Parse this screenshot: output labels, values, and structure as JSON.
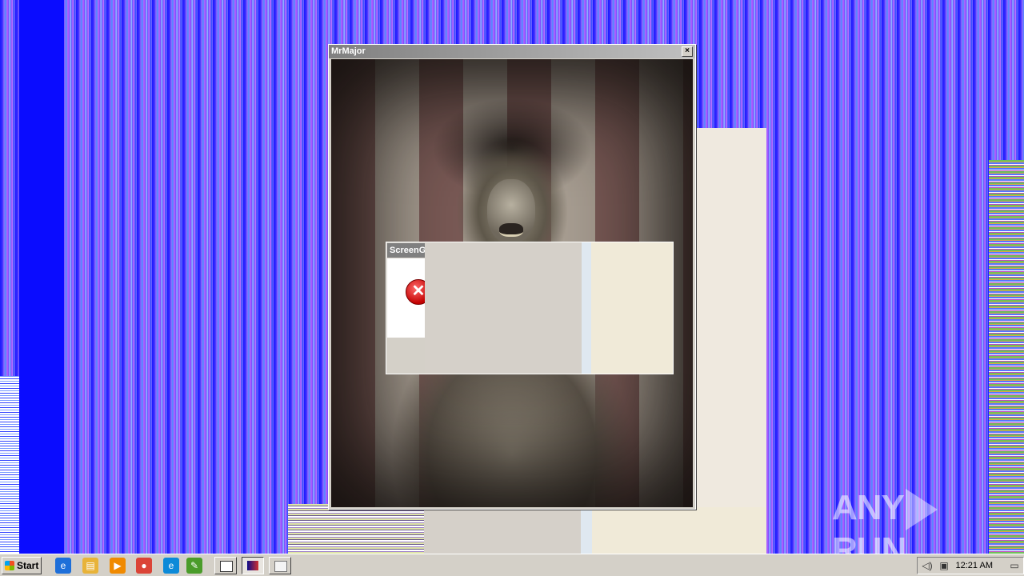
{
  "mrmajor_window": {
    "title": "MrMajor",
    "close_label": "×"
  },
  "error_dialog": {
    "title": "ScreenG",
    "icon": "error-icon",
    "icon_glyph": "✕"
  },
  "taskbar": {
    "start_label": "Start",
    "quick_launch": [
      {
        "name": "internet-explorer-icon",
        "glyph": "e",
        "color": "#1e6fd9"
      },
      {
        "name": "file-explorer-icon",
        "glyph": "▤",
        "color": "#e8b339"
      },
      {
        "name": "media-player-icon",
        "glyph": "▶",
        "color": "#f08a00"
      },
      {
        "name": "chrome-icon",
        "glyph": "●",
        "color": "#db4437"
      },
      {
        "name": "edge-icon",
        "glyph": "e",
        "color": "#0c8ad8"
      },
      {
        "name": "text-editor-icon",
        "glyph": "✎",
        "color": "#4a9c2a"
      }
    ],
    "clock": "12:21 AM"
  },
  "watermark": {
    "text_left": "ANY",
    "text_right": "RUN"
  }
}
